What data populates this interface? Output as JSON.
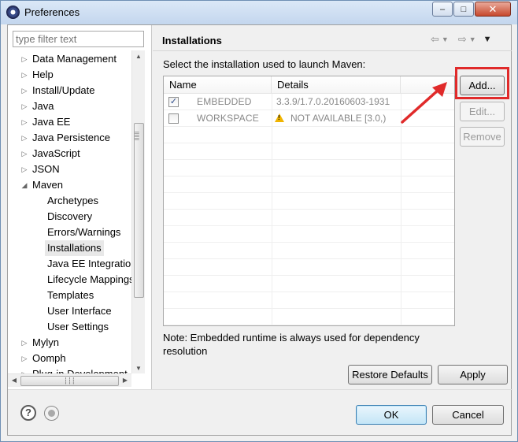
{
  "window": {
    "title": "Preferences",
    "minimize_glyph": "‒",
    "maximize_glyph": "□",
    "close_glyph": "✕"
  },
  "left": {
    "filter_placeholder": "type filter text",
    "tree": [
      {
        "label": "Data Management",
        "twisty": "collapsed",
        "level": 0
      },
      {
        "label": "Help",
        "twisty": "collapsed",
        "level": 0
      },
      {
        "label": "Install/Update",
        "twisty": "collapsed",
        "level": 0
      },
      {
        "label": "Java",
        "twisty": "collapsed",
        "level": 0
      },
      {
        "label": "Java EE",
        "twisty": "collapsed",
        "level": 0
      },
      {
        "label": "Java Persistence",
        "twisty": "collapsed",
        "level": 0
      },
      {
        "label": "JavaScript",
        "twisty": "collapsed",
        "level": 0
      },
      {
        "label": "JSON",
        "twisty": "collapsed",
        "level": 0
      },
      {
        "label": "Maven",
        "twisty": "expanded",
        "level": 0
      },
      {
        "label": "Archetypes",
        "twisty": "none",
        "level": 1
      },
      {
        "label": "Discovery",
        "twisty": "none",
        "level": 1
      },
      {
        "label": "Errors/Warnings",
        "twisty": "none",
        "level": 1
      },
      {
        "label": "Installations",
        "twisty": "none",
        "level": 1,
        "selected": true
      },
      {
        "label": "Java EE Integration",
        "twisty": "none",
        "level": 1
      },
      {
        "label": "Lifecycle Mappings",
        "twisty": "none",
        "level": 1
      },
      {
        "label": "Templates",
        "twisty": "none",
        "level": 1
      },
      {
        "label": "User Interface",
        "twisty": "none",
        "level": 1
      },
      {
        "label": "User Settings",
        "twisty": "none",
        "level": 1
      },
      {
        "label": "Mylyn",
        "twisty": "collapsed",
        "level": 0
      },
      {
        "label": "Oomph",
        "twisty": "collapsed",
        "level": 0
      },
      {
        "label": "Plug-in Development",
        "twisty": "collapsed",
        "level": 0
      }
    ]
  },
  "page": {
    "title": "Installations",
    "subtitle": "Select the installation used to launch Maven:",
    "nav": {
      "back_icon": "back-arrow-icon",
      "forward_icon": "forward-arrow-icon",
      "menu_icon": "view-menu-icon"
    },
    "table": {
      "columns": [
        "Name",
        "Details",
        ""
      ],
      "rows": [
        {
          "checked": true,
          "name": "EMBEDDED",
          "details": "3.3.9/1.7.0.20160603-1931",
          "warning": false
        },
        {
          "checked": false,
          "name": "WORKSPACE",
          "details": "NOT AVAILABLE [3.0,)",
          "warning": true
        }
      ]
    },
    "buttons": {
      "add": "Add...",
      "edit": "Edit...",
      "remove": "Remove"
    },
    "note": "Note: Embedded runtime is always used for dependency resolution",
    "restore_defaults": "Restore Defaults",
    "apply": "Apply"
  },
  "annotation": {
    "highlight_color": "#e02a2a"
  },
  "footer": {
    "ok": "OK",
    "cancel": "Cancel",
    "help_glyph": "?"
  }
}
